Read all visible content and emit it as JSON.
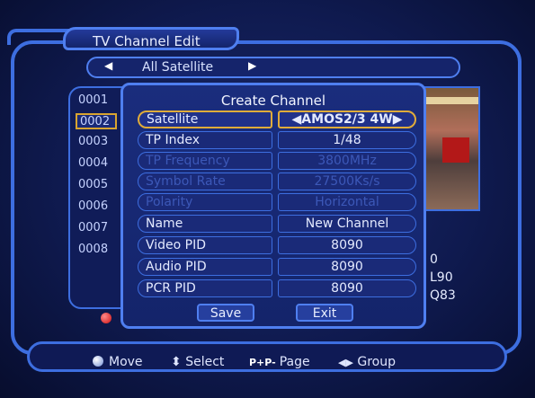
{
  "window": {
    "title": "TV Channel Edit"
  },
  "satellite_bar": {
    "label": "All Satellite"
  },
  "channel_list": {
    "items": [
      "0001",
      "0002",
      "0003",
      "0004",
      "0005",
      "0006",
      "0007",
      "0008"
    ],
    "selected_index": 1
  },
  "preview_info": {
    "line1": "0",
    "line2": "L90",
    "line3": "Q83"
  },
  "dialog": {
    "title": "Create Channel",
    "rows": [
      {
        "name": "Satellite",
        "value": "AMOS2/3 4W",
        "state": "selected"
      },
      {
        "name": "TP Index",
        "value": "1/48",
        "state": "normal"
      },
      {
        "name": "TP Frequency",
        "value": "3800MHz",
        "state": "disabled"
      },
      {
        "name": "Symbol Rate",
        "value": "27500Ks/s",
        "state": "disabled"
      },
      {
        "name": "Polarity",
        "value": "Horizontal",
        "state": "disabled"
      },
      {
        "name": "Name",
        "value": "New Channel",
        "state": "normal"
      },
      {
        "name": "Video PID",
        "value": "8090",
        "state": "normal"
      },
      {
        "name": "Audio PID",
        "value": "8090",
        "state": "normal"
      },
      {
        "name": "PCR PID",
        "value": "8090",
        "state": "normal"
      }
    ],
    "save_label": "Save",
    "exit_label": "Exit"
  },
  "hints": {
    "move": "Move",
    "select": "Select",
    "page_key": "P+P-",
    "page": "Page",
    "group": "Group"
  },
  "colors": {
    "accent_border": "#3d6ee0",
    "selected_border": "#e0ac3a",
    "disabled_text": "#3c58b8"
  }
}
